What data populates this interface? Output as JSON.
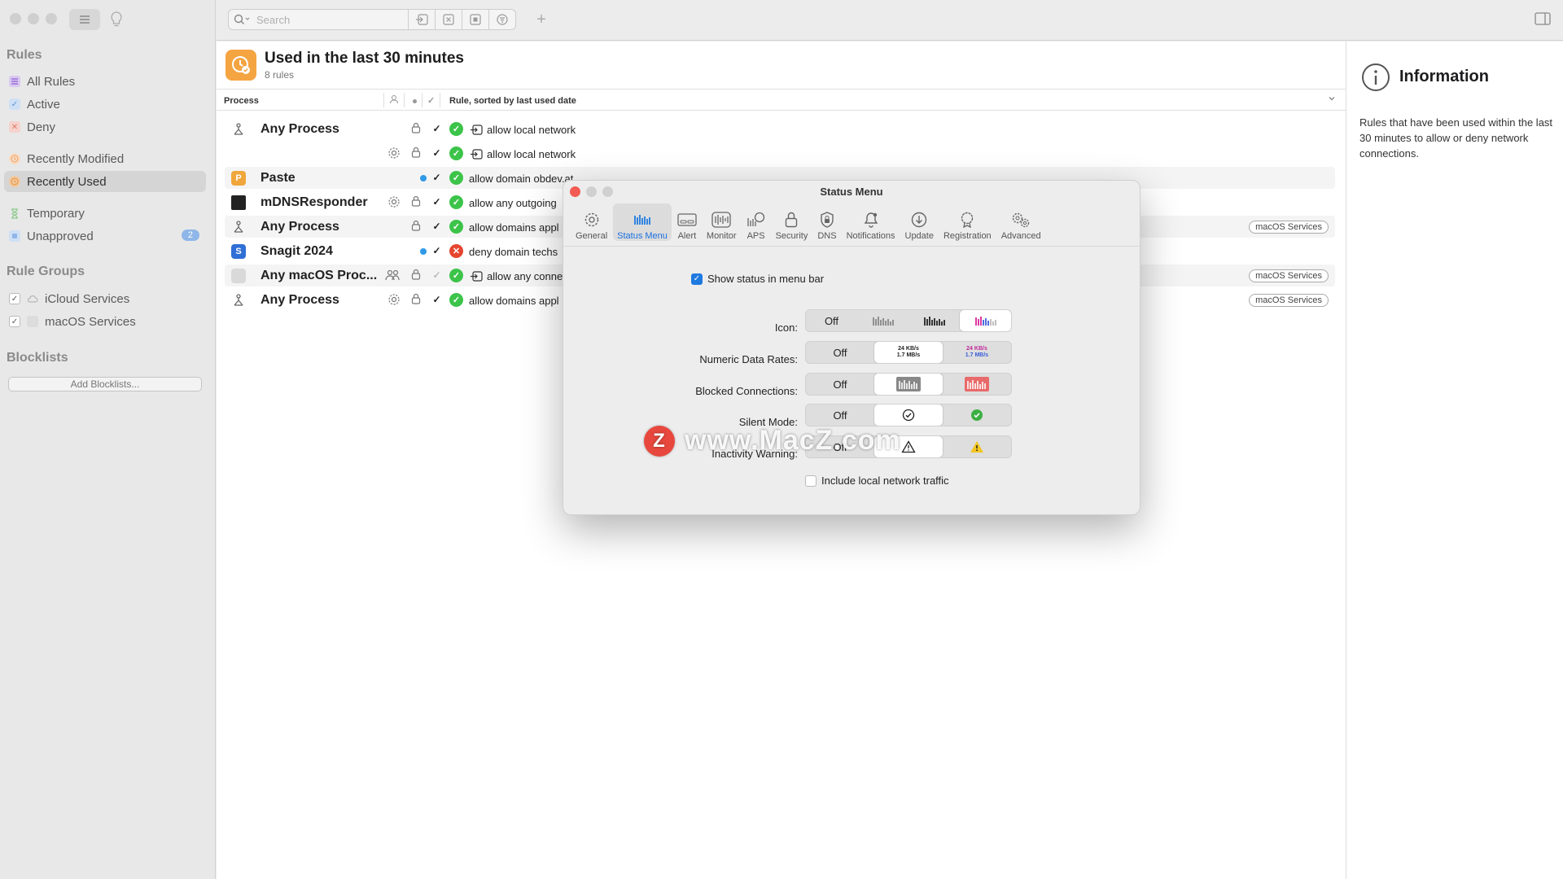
{
  "toolbar": {
    "search_placeholder": "Search"
  },
  "sidebar": {
    "rules_heading": "Rules",
    "items": [
      {
        "label": "All Rules"
      },
      {
        "label": "Active"
      },
      {
        "label": "Deny"
      },
      {
        "label": "Recently Modified"
      },
      {
        "label": "Recently Used"
      },
      {
        "label": "Temporary"
      },
      {
        "label": "Unapproved",
        "badge": "2"
      }
    ],
    "groups_heading": "Rule Groups",
    "groups": [
      {
        "label": "iCloud Services"
      },
      {
        "label": "macOS Services"
      }
    ],
    "blocklists_heading": "Blocklists",
    "add_blocklists": "Add Blocklists..."
  },
  "main": {
    "title": "Used in the last 30 minutes",
    "subtitle": "8 rules",
    "columns": {
      "process": "Process",
      "rule": "Rule, sorted by last used date"
    },
    "rows": [
      {
        "process": "Any Process",
        "rule": "allow local network"
      },
      {
        "process": "",
        "rule": "allow local network"
      },
      {
        "process": "Paste",
        "rule": "allow domain obdev.at"
      },
      {
        "process": "mDNSResponder",
        "rule": "allow any outgoing"
      },
      {
        "process": "Any Process",
        "rule": "allow domains appl",
        "tag": "macOS Services"
      },
      {
        "process": "Snagit 2024",
        "rule": "deny domain techs"
      },
      {
        "process": "Any macOS Proc...",
        "rule": "allow any conne",
        "tag": "macOS Services"
      },
      {
        "process": "Any Process",
        "rule": "allow domains appl",
        "tag": "macOS Services"
      }
    ]
  },
  "info": {
    "title": "Information",
    "text": "Rules that have been used within the last 30 minutes to allow or deny network connections."
  },
  "dialog": {
    "title": "Status Menu",
    "tabs": [
      "General",
      "Status Menu",
      "Alert",
      "Monitor",
      "APS",
      "Security",
      "DNS",
      "Notifications",
      "Update",
      "Registration",
      "Advanced"
    ],
    "selected_tab": "Status Menu",
    "show_status_label": "Show status in menu bar",
    "show_status_checked": true,
    "icon_label": "Icon:",
    "numeric_label": "Numeric Data Rates:",
    "blocked_label": "Blocked Connections:",
    "silent_label": "Silent Mode:",
    "inactivity_label": "Inactivity Warning:",
    "off": "Off",
    "rate_top": "24 KB/s",
    "rate_bottom": "1.7 MB/s",
    "include_local_label": "Include local network traffic",
    "include_local_checked": false
  },
  "watermark": {
    "letter": "Z",
    "text": "www.MacZ.com"
  },
  "colors": {
    "accent": "#1f7ae0",
    "allow": "#3cc44a",
    "deny": "#e6452f",
    "header_icon": "#f5a442"
  }
}
